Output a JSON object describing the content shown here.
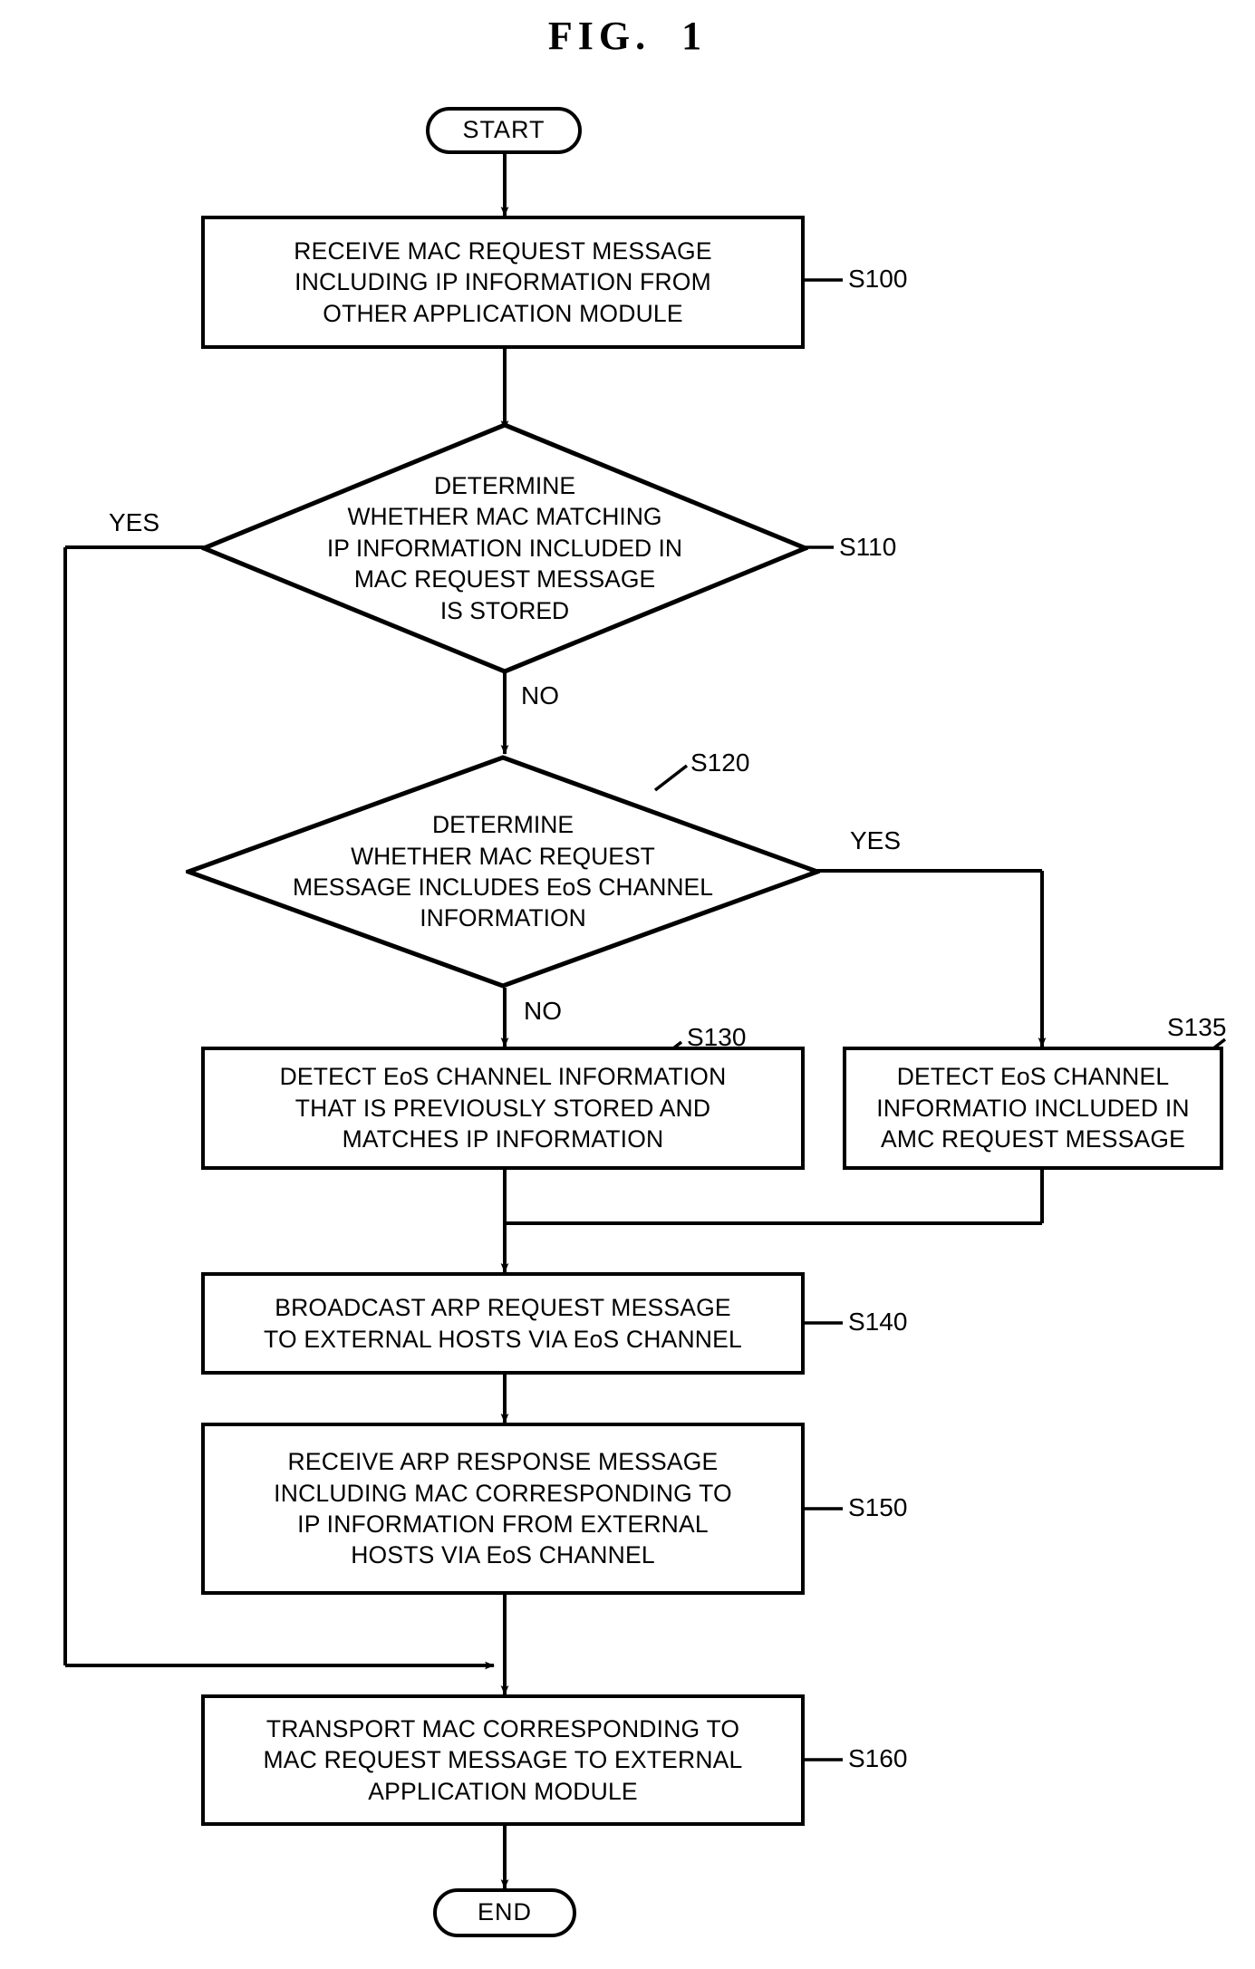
{
  "figure": {
    "title": "FIG.  1"
  },
  "nodes": {
    "start": {
      "label": "START",
      "type": "terminal"
    },
    "s100": {
      "text": "RECEIVE MAC REQUEST MESSAGE\nINCLUDING IP INFORMATION FROM\nOTHER APPLICATION MODULE",
      "step": "S100",
      "type": "process"
    },
    "s110": {
      "text": "DETERMINE\nWHETHER MAC MATCHING\nIP INFORMATION INCLUDED IN\nMAC REQUEST MESSAGE\nIS STORED",
      "step": "S110",
      "type": "decision",
      "yes_label": "YES",
      "no_label": "NO"
    },
    "s120": {
      "text": "DETERMINE\nWHETHER MAC REQUEST\nMESSAGE INCLUDES EoS CHANNEL\nINFORMATION",
      "step": "S120",
      "type": "decision",
      "yes_label": "YES",
      "no_label": "NO"
    },
    "s130": {
      "text": "DETECT EoS CHANNEL INFORMATION\nTHAT IS PREVIOUSLY STORED AND\nMATCHES IP INFORMATION",
      "step": "S130",
      "type": "process"
    },
    "s135": {
      "text": "DETECT EoS CHANNEL\nINFORMATIO INCLUDED IN\nAMC REQUEST MESSAGE",
      "step": "S135",
      "type": "process"
    },
    "s140": {
      "text": "BROADCAST ARP REQUEST MESSAGE\nTO EXTERNAL HOSTS VIA EoS CHANNEL",
      "step": "S140",
      "type": "process"
    },
    "s150": {
      "text": "RECEIVE ARP RESPONSE MESSAGE\nINCLUDING MAC CORRESPONDING TO\nIP INFORMATION FROM EXTERNAL\nHOSTS VIA EoS CHANNEL",
      "step": "S150",
      "type": "process"
    },
    "s160": {
      "text": "TRANSPORT MAC CORRESPONDING TO\nMAC REQUEST MESSAGE TO EXTERNAL\nAPPLICATION MODULE",
      "step": "S160",
      "type": "process"
    },
    "end": {
      "label": "END",
      "type": "terminal"
    }
  },
  "colors": {
    "stroke": "#000000",
    "background": "#ffffff"
  }
}
